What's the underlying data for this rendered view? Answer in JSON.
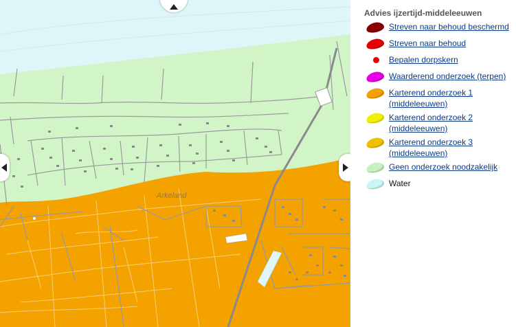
{
  "legend": {
    "title": "Advies ijzertijd-middeleeuwen",
    "items": [
      {
        "label": "Streven naar behoud beschermd",
        "color": "#8b0000",
        "shape": "blob",
        "link": true
      },
      {
        "label": "Streven naar behoud",
        "color": "#e60000",
        "shape": "blob",
        "link": true
      },
      {
        "label": "Bepalen dorpskern",
        "color": "#e60000",
        "shape": "dot",
        "link": true
      },
      {
        "label": "Waarderend onderzoek (terpen)",
        "color": "#e600e6",
        "shape": "blob",
        "link": true
      },
      {
        "label": "Karterend onderzoek 1 (middeleeuwen)",
        "color": "#f5a000",
        "shape": "blob",
        "link": true
      },
      {
        "label": "Karterend onderzoek 2 (middeleeuwen)",
        "color": "#f0f000",
        "shape": "blob",
        "link": true
      },
      {
        "label": "Karterend onderzoek 3 (middeleeuwen)",
        "color": "#f0c000",
        "shape": "blob",
        "link": true
      },
      {
        "label": "Geen onderzoek noodzakelijk",
        "color": "#c8f0c0",
        "shape": "blob",
        "link": true
      },
      {
        "label": "Water",
        "color": "#c8f5f5",
        "shape": "blob",
        "link": false
      }
    ]
  },
  "map": {
    "place_label": "Arkeland",
    "colors": {
      "water": "#dff6f8",
      "green": "#d2f5c8",
      "orange": "#f3a200",
      "road": "#9a9a9a",
      "field_line": "#f9cf7a"
    }
  },
  "nav": {
    "up_icon": "arrow-up-icon",
    "left_icon": "arrow-left-icon",
    "right_icon": "arrow-right-icon"
  }
}
